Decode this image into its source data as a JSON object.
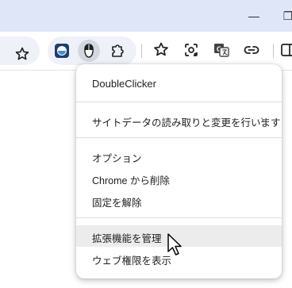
{
  "window": {
    "minimize_glyph": "—",
    "restore_glyph": "❐"
  },
  "toolbar": {
    "icons": [
      "star-icon",
      "extension-1-icon",
      "doubleclicker-icon",
      "puzzle-icon",
      "bookmark-star-icon",
      "lens-icon",
      "translate-icon",
      "link-icon",
      "side-panel-icon"
    ]
  },
  "menu": {
    "title": "DoubleClicker",
    "site_access": "サイトデータの読み取りと変更を行います",
    "site_access_chevron": "›",
    "options": "オプション",
    "remove": "Chrome から削除",
    "unpin": "固定を解除",
    "manage": "拡張機能を管理",
    "web_permissions": "ウェブ権限を表示"
  },
  "colors": {
    "titlebar": "#dfe6f7",
    "pill": "#eef1f8",
    "hover": "#ececec"
  }
}
